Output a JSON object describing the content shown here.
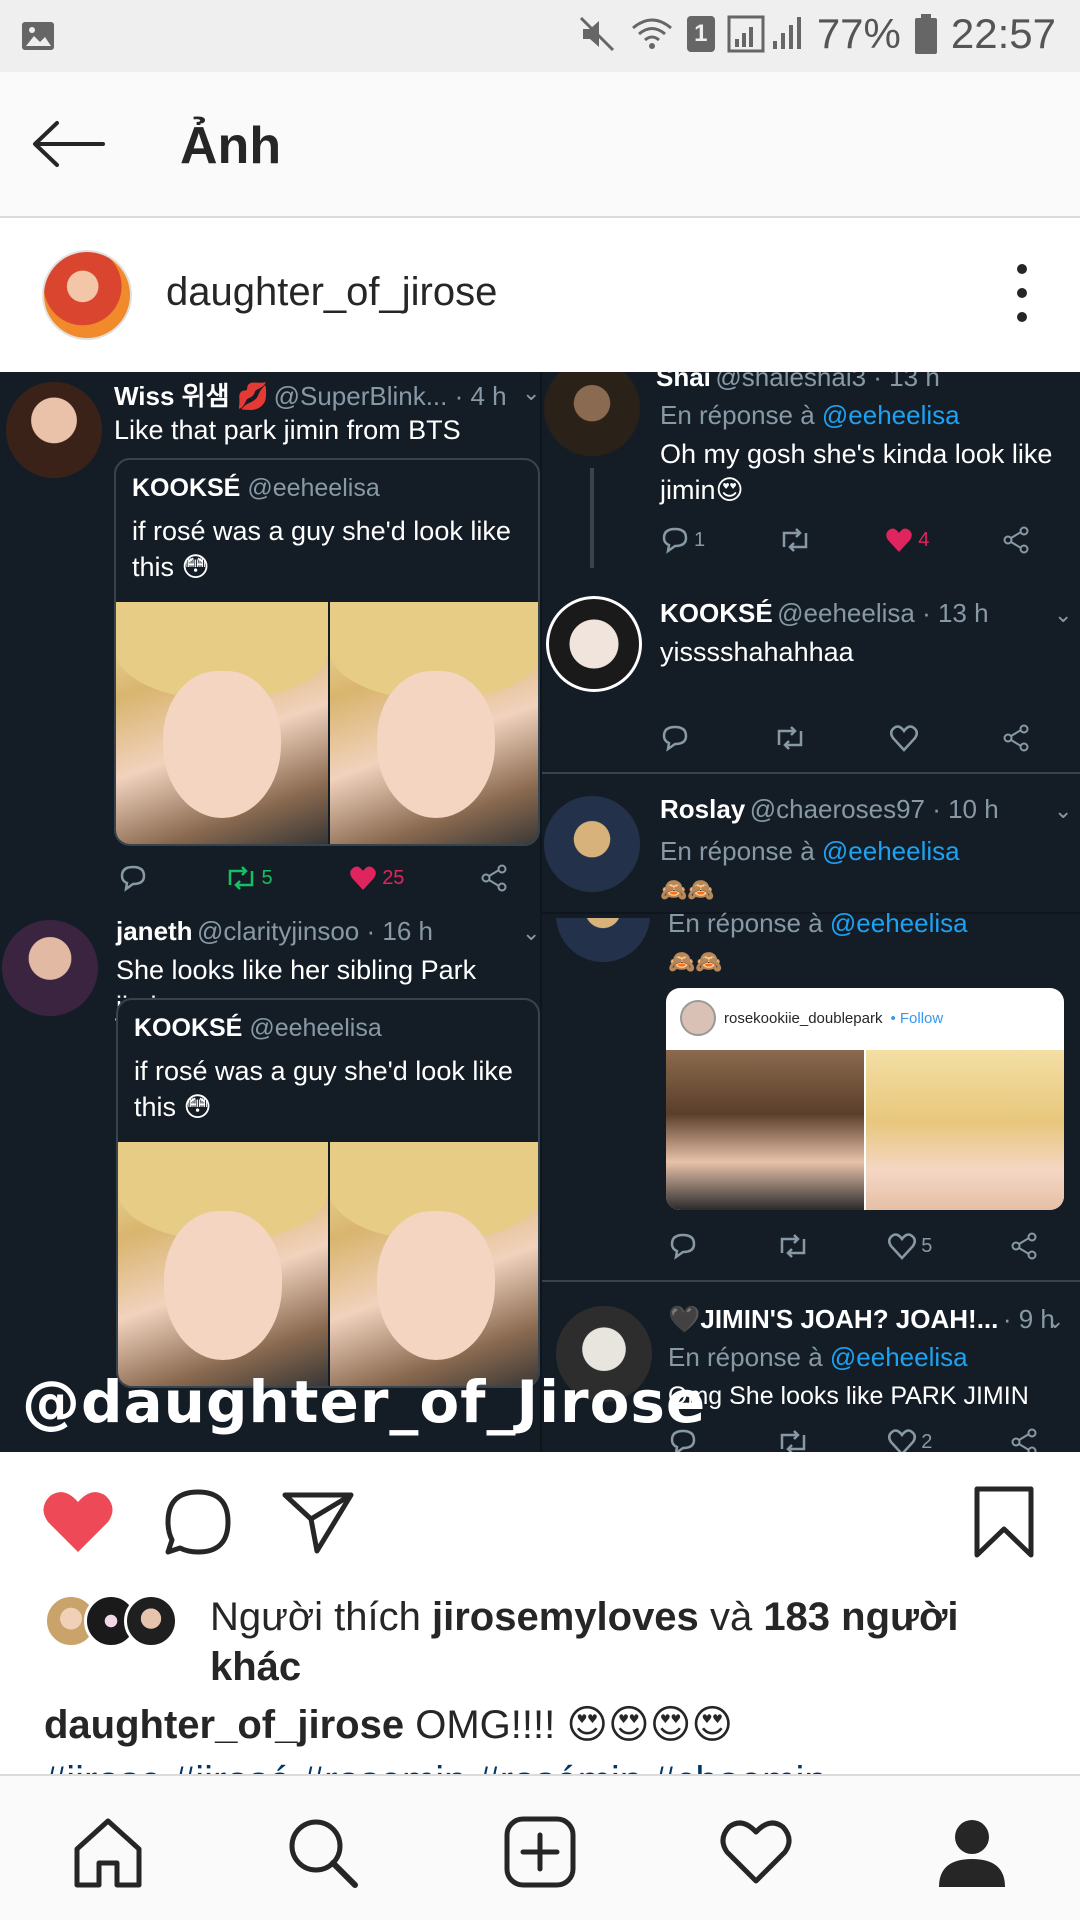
{
  "status_bar": {
    "battery": "77%",
    "time": "22:57",
    "sim_badge": "1",
    "icons": [
      "gallery-icon",
      "mute-icon",
      "wifi-icon",
      "sim-icon",
      "signal-icon",
      "battery-icon"
    ]
  },
  "app_bar": {
    "title": "Ảnh",
    "back_icon": "arrow-left-icon"
  },
  "post": {
    "username": "daughter_of_jirose",
    "more_icon": "vertical-dots-icon"
  },
  "post_image": {
    "watermark": "@daughter_of_Jirose",
    "left_column": [
      {
        "name": "Wiss 위샘 💋",
        "handle": "@SuperBlink... · 4 h",
        "text": "Like that park jimin from BTS",
        "quote": {
          "name": "KOOKSÉ",
          "handle": "@eeheelisa",
          "text": "if rosé was a guy she'd look like this 😳"
        },
        "retweets": "5",
        "likes": "25"
      },
      {
        "name": "janeth",
        "handle": "@clarityjinsoo · 16 h",
        "text": "She looks like her sibling Park jimin",
        "quote": {
          "name": "KOOKSÉ",
          "handle": "@eeheelisa",
          "text": "if rosé was a guy she'd look like this 😳"
        }
      }
    ],
    "right_column": [
      {
        "name": "Shai",
        "handle": "@shaleshai3 · 13 h",
        "reply_prefix": "En réponse à",
        "reply_to": "@eeheelisa",
        "text": "Oh my gosh she's kinda look like jimin😍",
        "replies": "1",
        "likes": "4"
      },
      {
        "name": "KOOKSÉ",
        "handle": "@eeheelisa · 13 h",
        "text": "yisssshahahhaa"
      },
      {
        "name": "Roslay",
        "handle": "@chaeroses97 · 10 h",
        "reply_prefix": "En réponse à",
        "reply_to": "@eeheelisa",
        "text": "🙈🙈"
      },
      {
        "reply_prefix": "En réponse à",
        "reply_to": "@eeheelisa",
        "text": "🙈🙈",
        "ig_card": {
          "account": "rosekookiie_doublepark",
          "follow": "• Follow"
        },
        "likes": "5"
      },
      {
        "name": "🖤JIMIN'S JOAH? JOAH!...",
        "handle": "· 9 h",
        "reply_prefix": "En réponse à",
        "reply_to": "@eeheelisa",
        "text": "Omg She looks like PARK JIMIN",
        "likes": "2"
      }
    ]
  },
  "actions": {
    "like_icon": "heart-filled-icon",
    "comment_icon": "comment-icon",
    "share_icon": "send-icon",
    "save_icon": "bookmark-icon",
    "like_color": "#ed4956"
  },
  "likes": {
    "prefix": "Người thích",
    "user": "jirosemyloves",
    "conjunction": "và",
    "others": "183 người khác"
  },
  "caption": {
    "username": "daughter_of_jirose",
    "text": "OMG!!!! 😍😍😍😍",
    "hashtags": "#jirose #jirosé #rosemin #rosémin #chaemin"
  },
  "bottom_nav": {
    "items": [
      "home-icon",
      "search-icon",
      "add-icon",
      "activity-icon",
      "profile-icon"
    ]
  }
}
